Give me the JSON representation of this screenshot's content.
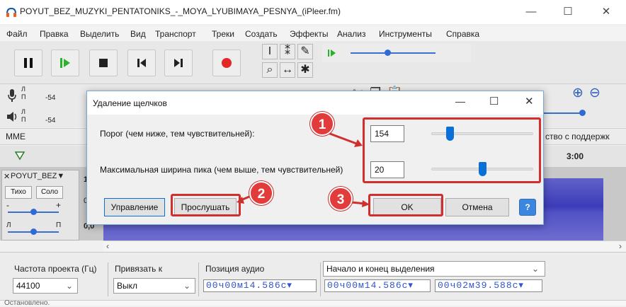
{
  "window": {
    "title": "POYUT_BEZ_MUZYKI_PENTATONIKS_-_MOYA_LYUBIMAYA_PESNYA_(iPleer.fm)",
    "controls": {
      "minimize": "—",
      "maximize": "☐",
      "close": "✕"
    }
  },
  "menu": [
    "Файл",
    "Правка",
    "Выделить",
    "Вид",
    "Транспорт",
    "Треки",
    "Создать",
    "Эффекты",
    "Анализ",
    "Инструменты",
    "Справка"
  ],
  "meters": {
    "rec_l": "Л",
    "rec_r": "П",
    "rec_db": "-54",
    "play_l": "Л",
    "play_r": "П",
    "play_db": "-54"
  },
  "device_bar": {
    "host": "MME",
    "right_text": "ство с поддержк"
  },
  "timeline": {
    "mark": "3:00"
  },
  "track": {
    "name": "POYUT_BEZ▼",
    "mute": "Тихо",
    "solo": "Соло",
    "gain_minus": "-",
    "gain_plus": "+",
    "pan_l": "Л",
    "pan_r": "П",
    "scale_top": "1,",
    "scale_mid": "0,",
    "scale_bot": "0,0"
  },
  "dialog": {
    "title": "Удаление щелчков",
    "threshold_label": "Порог (чем ниже, тем чувствительней):",
    "threshold_value": "154",
    "threshold_level": 0.18,
    "width_label": "Максимальная ширина пика (чем выше, тем чувствительней)",
    "width_value": "20",
    "width_level": 0.5,
    "manage_label": "Управление",
    "preview_label": "Прослушать",
    "ok_label": "OK",
    "cancel_label": "Отмена",
    "help_label": "?",
    "win_min": "—",
    "win_max": "☐",
    "win_close": "✕"
  },
  "badges": [
    "1",
    "2",
    "3"
  ],
  "bottom": {
    "rate_label": "Частота проекта (Гц)",
    "rate_value": "44100",
    "snap_label": "Привязать к",
    "snap_value": "Выкл",
    "pos_label": "Позиция аудио",
    "pos_value": "00ч00м14.586с▾",
    "sel_label": "Начало и конец выделения",
    "sel_start": "00ч00м14.586с▾",
    "sel_end": "00ч02м39.588с▾",
    "status": "Остановлено."
  },
  "colors": {
    "accent": "#0a6fd6",
    "highlight": "#d12e2e",
    "waveform": "#3c3cb9"
  }
}
